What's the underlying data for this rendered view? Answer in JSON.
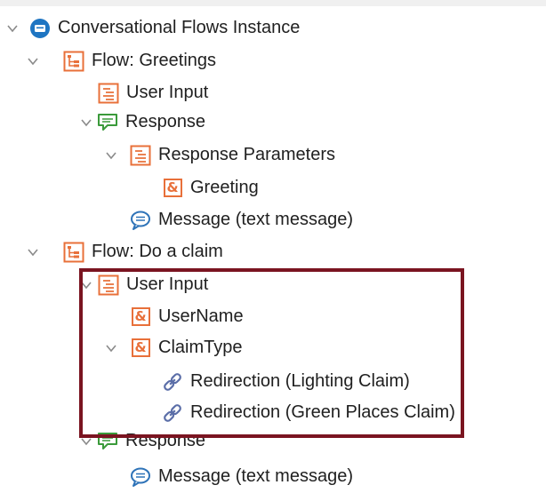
{
  "tree": {
    "root": {
      "label": "Conversational Flows Instance",
      "icon": "conversational-flows-instance-icon"
    },
    "flow_greetings": {
      "label": "Flow: Greetings",
      "icon": "flow-icon",
      "user_input": {
        "label": "User Input",
        "icon": "user-input-icon"
      },
      "response": {
        "label": "Response",
        "icon": "response-icon",
        "parameters": {
          "label": "Response Parameters",
          "icon": "response-parameters-icon",
          "greeting": {
            "label": "Greeting",
            "icon": "parameter-icon"
          }
        },
        "message": {
          "label": "Message (text message)",
          "icon": "message-icon"
        }
      }
    },
    "flow_claim": {
      "label": "Flow: Do a claim",
      "icon": "flow-icon",
      "user_input": {
        "label": "User Input",
        "icon": "user-input-icon",
        "username": {
          "label": "UserName",
          "icon": "parameter-icon"
        },
        "claimtype": {
          "label": "ClaimType",
          "icon": "parameter-icon",
          "redirect_lighting": {
            "label": "Redirection (Lighting Claim)",
            "icon": "redirection-link-icon"
          },
          "redirect_green": {
            "label": "Redirection (Green Places Claim)",
            "icon": "redirection-link-icon"
          }
        }
      },
      "response": {
        "label": "Response",
        "icon": "response-icon",
        "message": {
          "label": "Message (text message)",
          "icon": "message-icon"
        }
      }
    }
  },
  "colors": {
    "orange_icon": "#e8703a",
    "green_icon": "#3a9a3a",
    "blue_icon": "#2e73b8",
    "highlight_border": "#7a1420"
  }
}
